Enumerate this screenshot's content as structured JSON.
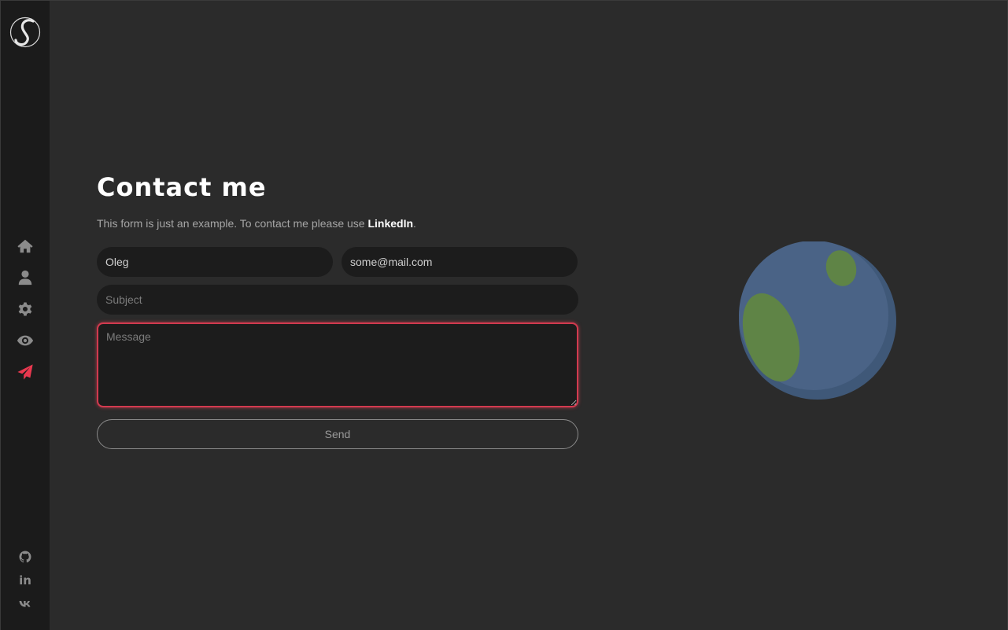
{
  "app": {
    "logo_icon": "script-s-logo-icon"
  },
  "nav": {
    "items": [
      {
        "name": "home",
        "icon": "home-icon",
        "active": false
      },
      {
        "name": "about",
        "icon": "user-icon",
        "active": false
      },
      {
        "name": "skills",
        "icon": "gear-icon",
        "active": false
      },
      {
        "name": "portfolio",
        "icon": "eye-icon",
        "active": false
      },
      {
        "name": "contact",
        "icon": "paper-plane-icon",
        "active": true
      }
    ],
    "active_color": "#e8384f",
    "icon_color": "#8b8b8b"
  },
  "social": {
    "github_icon": "github-icon",
    "linkedin_label": "in",
    "vk_icon": "vk-icon"
  },
  "contact": {
    "title": "Contact me",
    "intro_text": "This form is just an example. To contact me please use ",
    "intro_link": "LinkedIn",
    "intro_end": ".",
    "name_value": "Oleg",
    "email_value": "some@mail.com",
    "subject_placeholder": "Subject",
    "message_placeholder": "Message",
    "send_label": "Send"
  },
  "colors": {
    "background": "#2b2b2b",
    "sidebar": "#1b1b1b",
    "field": "#1c1c1c",
    "focus_border": "#d23a4f",
    "planet_ocean": "#4a6386",
    "planet_land": "#5f8446"
  }
}
